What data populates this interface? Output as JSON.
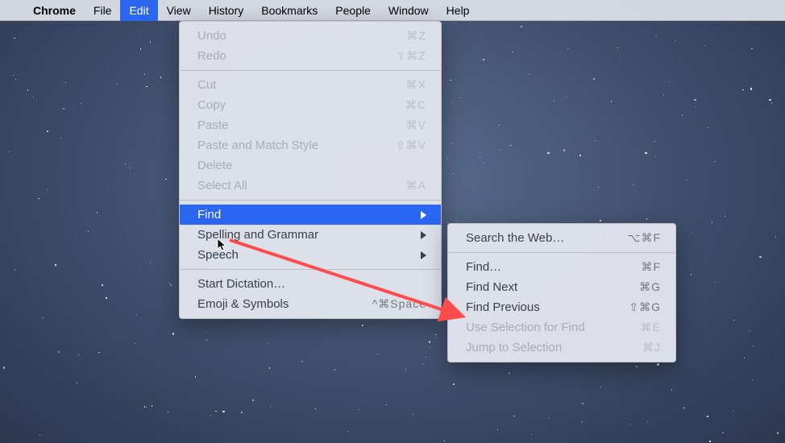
{
  "menubar": {
    "appname": "Chrome",
    "items": [
      "File",
      "Edit",
      "View",
      "History",
      "Bookmarks",
      "People",
      "Window",
      "Help"
    ],
    "selected": "Edit"
  },
  "editMenu": {
    "undo": "Undo",
    "undo_sc": "⌘Z",
    "redo": "Redo",
    "redo_sc": "⇧⌘Z",
    "cut": "Cut",
    "cut_sc": "⌘X",
    "copy": "Copy",
    "copy_sc": "⌘C",
    "paste": "Paste",
    "paste_sc": "⌘V",
    "pasteMatch": "Paste and Match Style",
    "pasteMatch_sc": "⇧⌘V",
    "delete": "Delete",
    "selectAll": "Select All",
    "selectAll_sc": "⌘A",
    "find": "Find",
    "spelling": "Spelling and Grammar",
    "speech": "Speech",
    "dictation": "Start Dictation…",
    "emoji": "Emoji & Symbols",
    "emoji_sc": "^⌘Space"
  },
  "findMenu": {
    "searchWeb": "Search the Web…",
    "searchWeb_sc": "⌥⌘F",
    "find": "Find…",
    "find_sc": "⌘F",
    "findNext": "Find Next",
    "findNext_sc": "⌘G",
    "findPrev": "Find Previous",
    "findPrev_sc": "⇧⌘G",
    "useSel": "Use Selection for Find",
    "useSel_sc": "⌘E",
    "jump": "Jump to Selection",
    "jump_sc": "⌘J"
  },
  "annotation": {
    "color": "#ff4b4b"
  }
}
